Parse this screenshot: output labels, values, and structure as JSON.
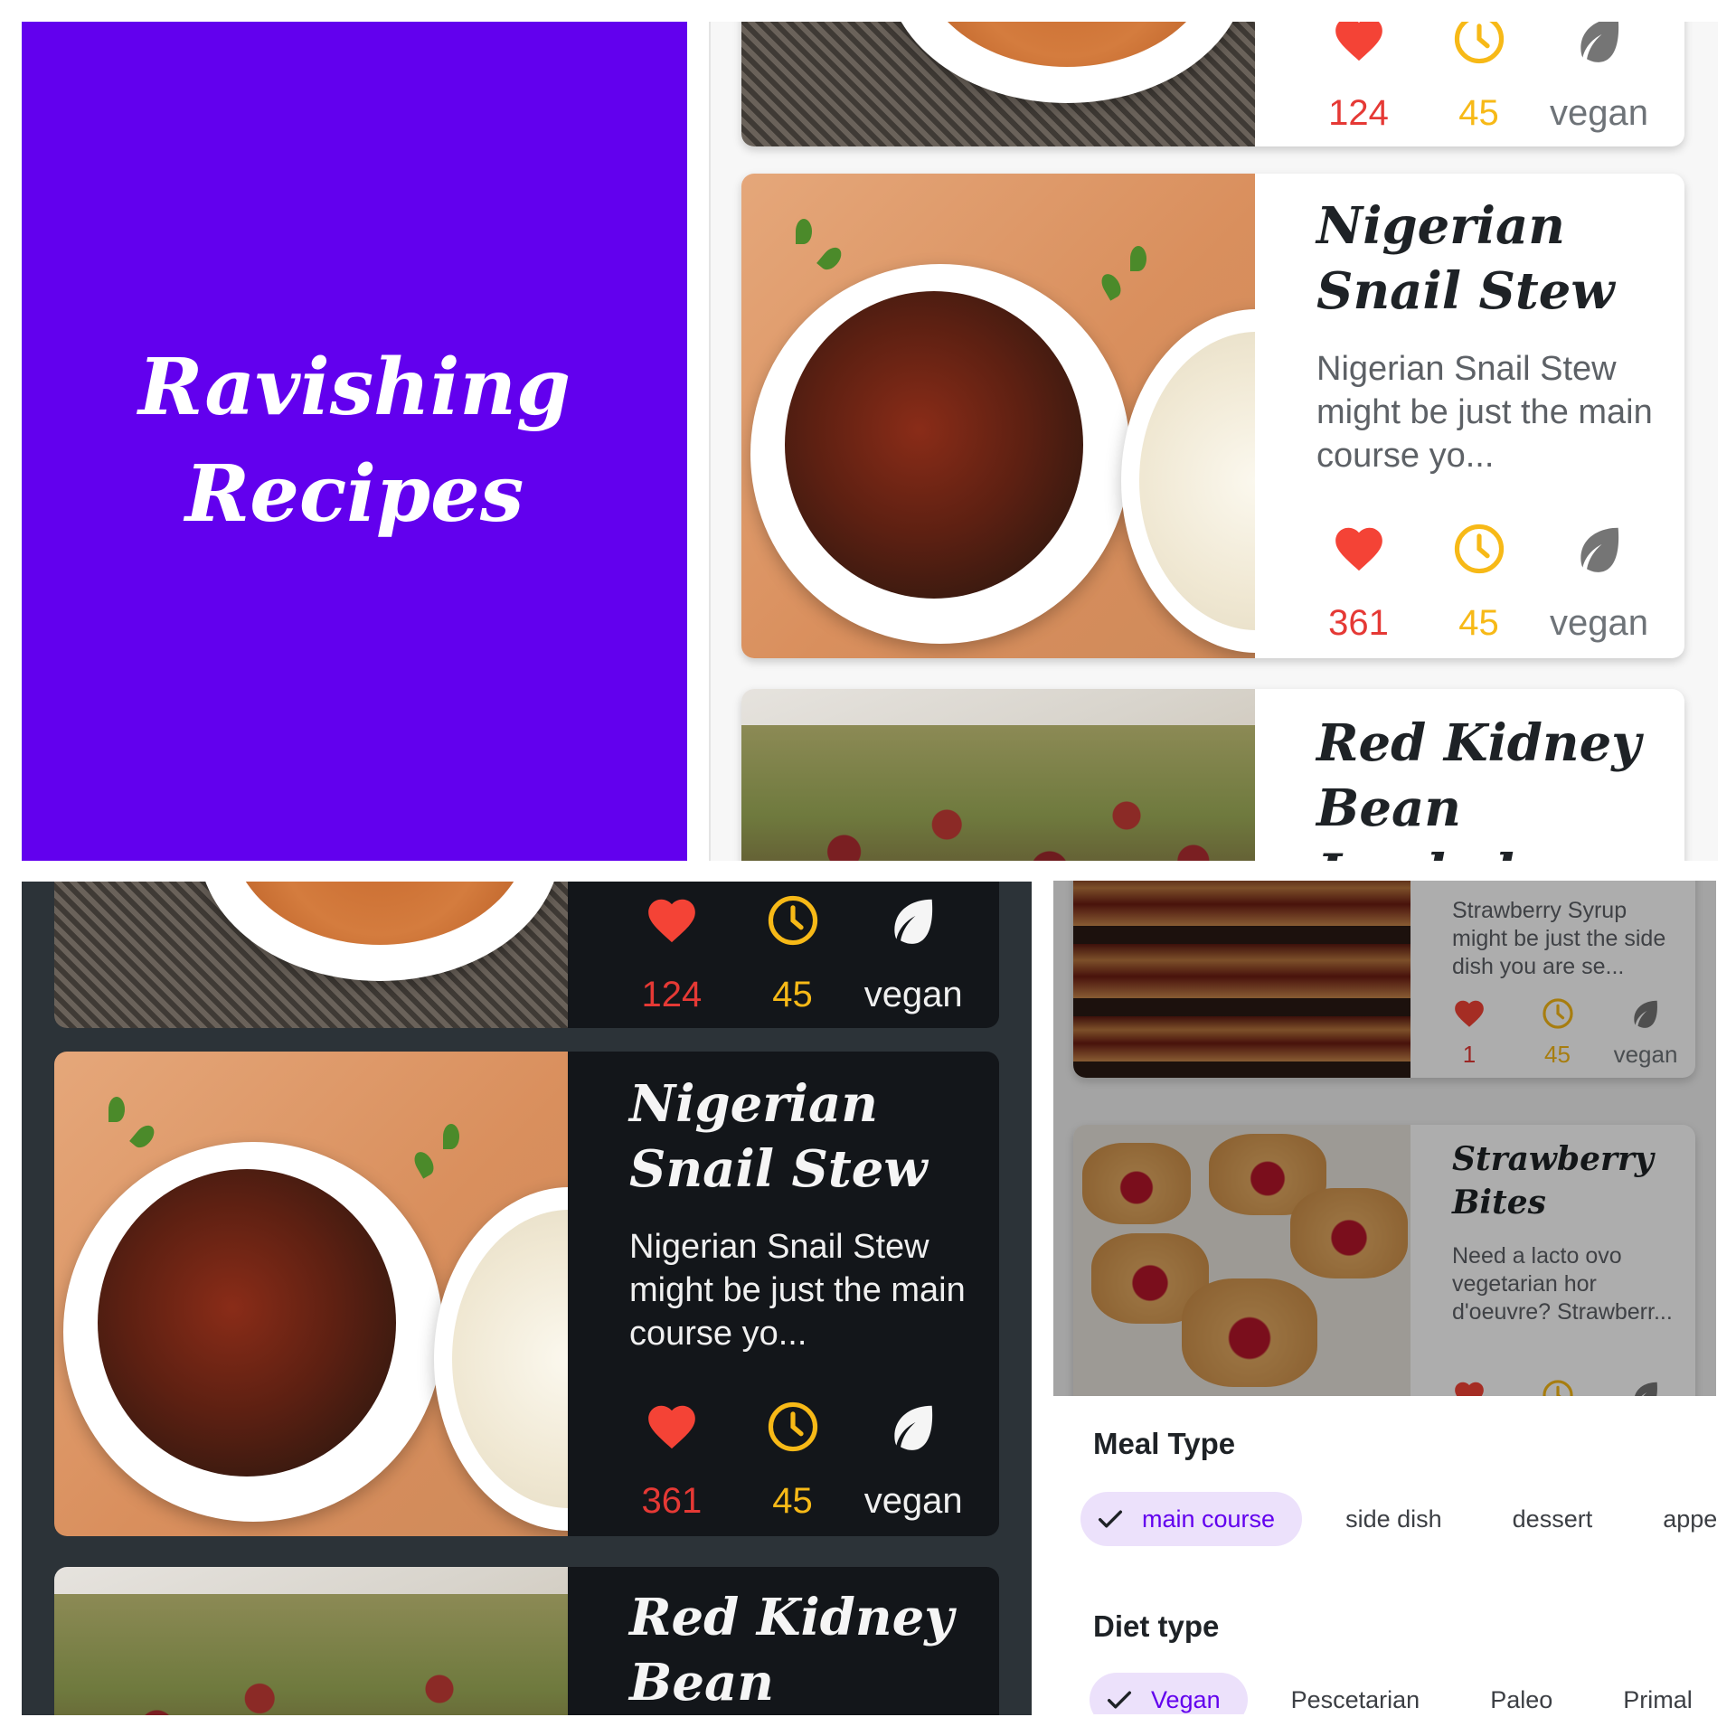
{
  "splash": {
    "line1": "Ravishing",
    "line2": "Recipes",
    "background": "#6200ee"
  },
  "recipes": [
    {
      "title": "",
      "likes": "124",
      "minutes": "45",
      "diet": "vegan"
    },
    {
      "title": "Nigerian Snail Stew",
      "description": "Nigerian Snail Stew might be just the main course yo...",
      "likes": "361",
      "minutes": "45",
      "diet": "vegan"
    },
    {
      "title": "Red Kidney Bean Jambal...",
      "title_cut": "Red Kidney Bean Jambal"
    }
  ],
  "filter_screen": {
    "recipes": [
      {
        "description": "Strawberry Syrup might be just the side dish you are se...",
        "likes": "1",
        "minutes": "45",
        "diet": "vegan"
      },
      {
        "title": "Strawberry Bites",
        "description": "Need a lacto ovo vegetarian hor d'oeuvre? Strawberr..."
      }
    ],
    "meal_type": {
      "heading": "Meal Type",
      "chips": [
        "main course",
        "side dish",
        "dessert",
        "appeti:"
      ],
      "selected": "main course"
    },
    "diet_type": {
      "heading": "Diet type",
      "chips": [
        "Vegan",
        "Pescetarian",
        "Paleo",
        "Primal"
      ],
      "selected": "Vegan"
    }
  },
  "icons": {
    "like": "heart-icon",
    "time": "clock-icon",
    "diet": "leaf-icon"
  },
  "colors": {
    "primary": "#6200ee",
    "heart": "#e53935",
    "clock": "#f7b917",
    "dark_card": "#13161a",
    "dark_bg": "#2c3338",
    "chip_selected_bg": "#ece1fb"
  }
}
